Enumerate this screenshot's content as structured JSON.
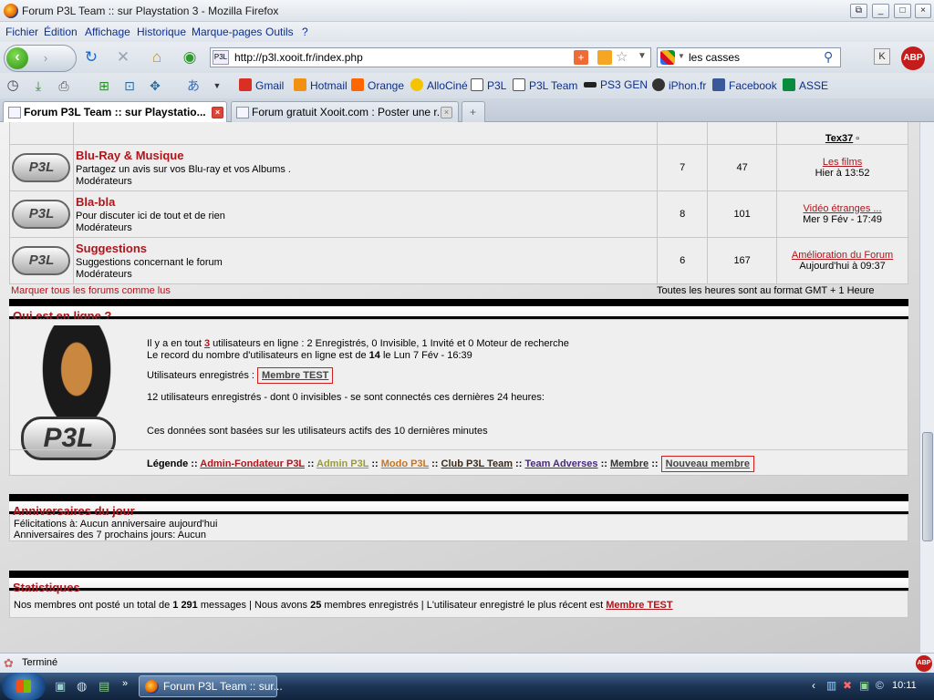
{
  "window": {
    "title": "Forum P3L Team :: sur Playstation 3 - Mozilla Firefox"
  },
  "menu": [
    "Fichier",
    "Édition",
    "Affichage",
    "Historique",
    "Marque-pages",
    "Outils",
    "?"
  ],
  "address": {
    "url": "http://p3l.xooit.fr/index.php"
  },
  "search": {
    "value": "les casses"
  },
  "bookmarks": [
    {
      "label": "Gmail",
      "color": "#d93025"
    },
    {
      "label": "Hotmail",
      "color": "#f29111"
    },
    {
      "label": "Orange",
      "color": "#ff6600"
    },
    {
      "label": "AlloCiné",
      "color": "#f5c400"
    },
    {
      "label": "P3L",
      "color": "#555555"
    },
    {
      "label": "P3L Team",
      "color": "#555555"
    },
    {
      "label": "PS3 GEN",
      "color": "#222222"
    },
    {
      "label": "iPhon.fr",
      "color": "#333333"
    },
    {
      "label": "Facebook",
      "color": "#3b5998"
    },
    {
      "label": "ASSE",
      "color": "#0a8a3c"
    }
  ],
  "tabs": [
    {
      "label": "Forum P3L Team :: sur Playstatio...",
      "active": true
    },
    {
      "label": "Forum gratuit Xooit.com : Poster une r...",
      "active": false
    }
  ],
  "forum": {
    "top_row_last": "Tex37",
    "rows": [
      {
        "name": "Blu-Ray & Musique",
        "desc": "Partagez un avis sur vos Blu-ray et vos Albums .",
        "moderators": "Modérateurs",
        "topics": "7",
        "posts": "47",
        "last_title": "Les films",
        "last_date": "Hier à 13:52"
      },
      {
        "name": "Bla-bla",
        "desc": "Pour discuter ici de tout et de rien",
        "moderators": "Modérateurs",
        "topics": "8",
        "posts": "101",
        "last_title": "Vidéo étranges ...",
        "last_date": "Mer 9 Fév - 17:49"
      },
      {
        "name": "Suggestions",
        "desc": "Suggestions concernant le forum",
        "moderators": "Modérateurs",
        "topics": "6",
        "posts": "167",
        "last_title": "Amélioration du Forum",
        "last_date": "Aujourd'hui à 09:37"
      }
    ],
    "mark_read": "Marquer tous les forums comme lus",
    "timezone": "Toutes les heures sont au format GMT + 1 Heure"
  },
  "online": {
    "heading": "Qui est en ligne ?",
    "line1_pre": "Il y a en tout ",
    "line1_count": "3",
    "line1_post": " utilisateurs en ligne : 2 Enregistrés, 0 Invisible, 1 Invité et 0 Moteur de recherche",
    "line2_pre": "Le record du nombre d'utilisateurs en ligne est de ",
    "line2_count": "14",
    "line2_post": " le Lun 7 Fév - 16:39",
    "registered_label": "Utilisateurs enregistrés : ",
    "registered_user": "Membre TEST",
    "last24": "12 utilisateurs enregistrés - dont 0 invisibles - se sont connectés ces dernières 24 heures:",
    "note": "Ces données sont basées sur les utilisateurs actifs des 10 dernières minutes",
    "legend_label": "Légende",
    "legend": [
      {
        "label": "Admin-Fondateur P3L",
        "color": "#b0151b"
      },
      {
        "label": "Admin P3L",
        "color": "#9a9a3c"
      },
      {
        "label": "Modo P3L",
        "color": "#c8741f"
      },
      {
        "label": "Club P3L Team",
        "color": "#3a2a1a"
      },
      {
        "label": "Team Adverses",
        "color": "#4a2a7a"
      },
      {
        "label": "Membre",
        "color": "#333333"
      },
      {
        "label": "Nouveau membre",
        "color": "#444444"
      }
    ]
  },
  "birthdays": {
    "heading": "Anniversaires du jour",
    "line1": "Félicitations à: Aucun anniversaire aujourd'hui",
    "line2": "Anniversaires des 7 prochains jours: Aucun"
  },
  "stats": {
    "heading": "Statistiques",
    "pre": "Nos membres ont posté un total de ",
    "messages": "1 291",
    "mid": " messages | Nous avons ",
    "members": "25",
    "post": " membres enregistrés | L'utilisateur enregistré le plus récent est ",
    "newest": "Membre TEST"
  },
  "status": {
    "text": "Terminé"
  },
  "taskbar": {
    "window": "Forum P3L Team :: sur...",
    "clock": "10:11"
  }
}
